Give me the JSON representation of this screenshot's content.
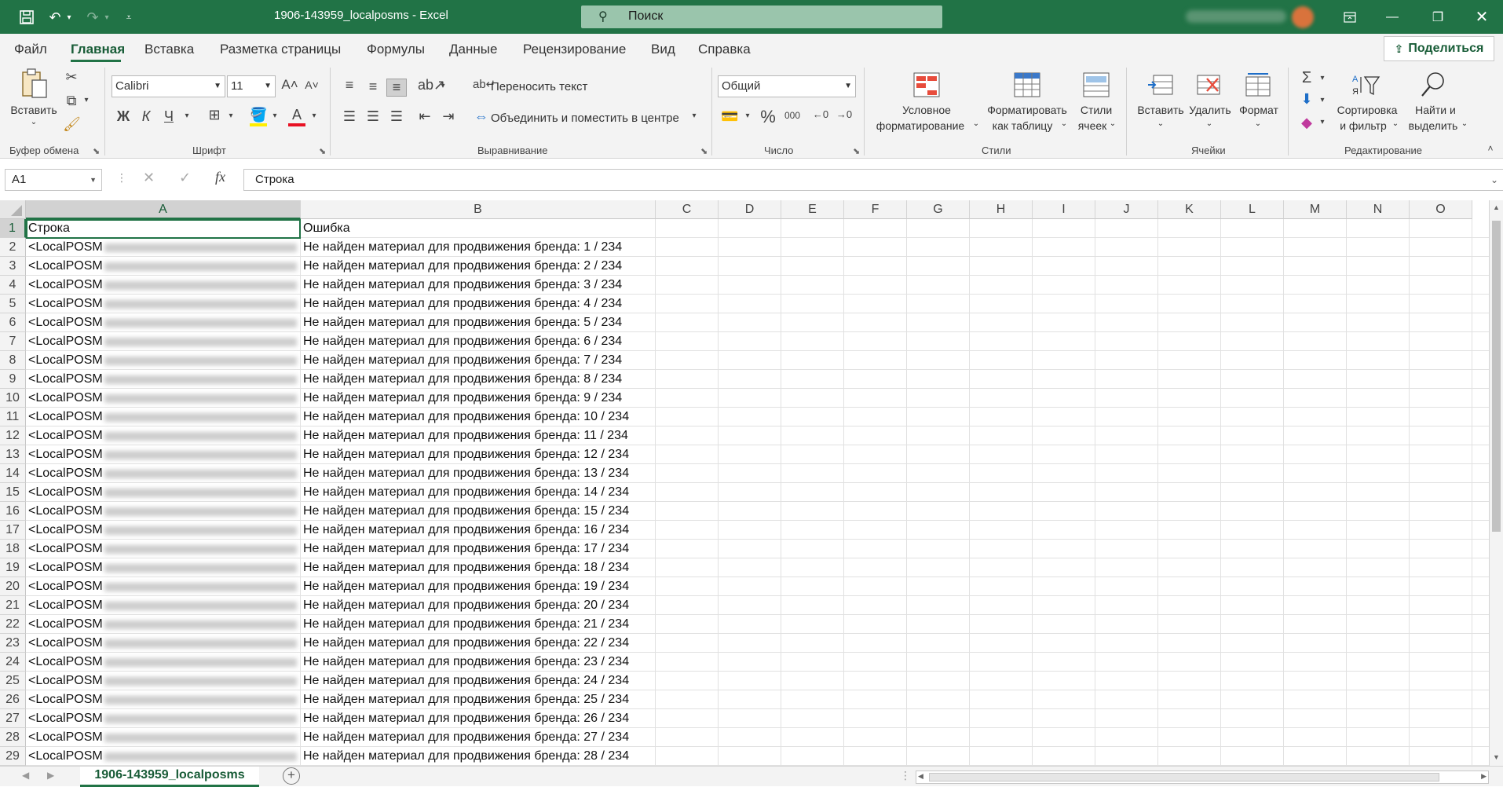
{
  "titlebar": {
    "title": "1906-143959_localposms  -  Excel",
    "search_placeholder": "Поиск",
    "accent": "#217346"
  },
  "menu": {
    "tabs": [
      "Файл",
      "Главная",
      "Вставка",
      "Разметка страницы",
      "Формулы",
      "Данные",
      "Рецензирование",
      "Вид",
      "Справка"
    ],
    "share_label": "Поделиться"
  },
  "ribbon": {
    "clipboard": {
      "paste_label": "Вставить",
      "group_label": "Буфер обмена"
    },
    "font": {
      "font_name": "Calibri",
      "font_size": "11",
      "group_label": "Шрифт",
      "bold": "Ж",
      "italic": "К",
      "underline": "Ч",
      "font_color": "#e81123"
    },
    "alignment": {
      "wrap_text": "Переносить текст",
      "merge_center": "Объединить и поместить в центре",
      "group_label": "Выравнивание"
    },
    "number": {
      "format": "Общий",
      "group_label": "Число"
    },
    "styles": {
      "conditional_line1": "Условное",
      "conditional_line2": "форматирование",
      "format_table_line1": "Форматировать",
      "format_table_line2": "как таблицу",
      "cell_styles_line1": "Стили",
      "cell_styles_line2": "ячеек",
      "group_label": "Стили"
    },
    "cells": {
      "insert": "Вставить",
      "delete": "Удалить",
      "format": "Формат",
      "group_label": "Ячейки"
    },
    "editing": {
      "sort_line1": "Сортировка",
      "sort_line2": "и фильтр",
      "find_line1": "Найти и",
      "find_line2": "выделить",
      "group_label": "Редактирование"
    }
  },
  "formula_bar": {
    "name_box": "A1",
    "content": "Строка"
  },
  "grid": {
    "columns": [
      "A",
      "B",
      "C",
      "D",
      "E",
      "F",
      "G",
      "H",
      "I",
      "J",
      "K",
      "L",
      "M",
      "N",
      "O"
    ],
    "selected_column": "A",
    "selected_row": "1",
    "rows": [
      {
        "num": "1",
        "a": "Строка",
        "b": "Ошибка"
      },
      {
        "num": "2",
        "a": "<LocalPOSM",
        "b": "Не найден материал для продвижения бренда: 1 / 234"
      },
      {
        "num": "3",
        "a": "<LocalPOSM",
        "b": "Не найден материал для продвижения бренда: 2 / 234"
      },
      {
        "num": "4",
        "a": "<LocalPOSM",
        "b": "Не найден материал для продвижения бренда: 3 / 234"
      },
      {
        "num": "5",
        "a": "<LocalPOSM",
        "b": "Не найден материал для продвижения бренда: 4 / 234"
      },
      {
        "num": "6",
        "a": "<LocalPOSM",
        "b": "Не найден материал для продвижения бренда: 5 / 234"
      },
      {
        "num": "7",
        "a": "<LocalPOSM",
        "b": "Не найден материал для продвижения бренда: 6 / 234"
      },
      {
        "num": "8",
        "a": "<LocalPOSM",
        "b": "Не найден материал для продвижения бренда: 7 / 234"
      },
      {
        "num": "9",
        "a": "<LocalPOSM",
        "b": "Не найден материал для продвижения бренда: 8 / 234"
      },
      {
        "num": "10",
        "a": "<LocalPOSM",
        "b": "Не найден материал для продвижения бренда: 9 / 234"
      },
      {
        "num": "11",
        "a": "<LocalPOSM",
        "b": "Не найден материал для продвижения бренда: 10 / 234"
      },
      {
        "num": "12",
        "a": "<LocalPOSM",
        "b": "Не найден материал для продвижения бренда: 11 / 234"
      },
      {
        "num": "13",
        "a": "<LocalPOSM",
        "b": "Не найден материал для продвижения бренда: 12 / 234"
      },
      {
        "num": "14",
        "a": "<LocalPOSM",
        "b": "Не найден материал для продвижения бренда: 13 / 234"
      },
      {
        "num": "15",
        "a": "<LocalPOSM",
        "b": "Не найден материал для продвижения бренда: 14 / 234"
      },
      {
        "num": "16",
        "a": "<LocalPOSM",
        "b": "Не найден материал для продвижения бренда: 15 / 234"
      },
      {
        "num": "17",
        "a": "<LocalPOSM",
        "b": "Не найден материал для продвижения бренда: 16 / 234"
      },
      {
        "num": "18",
        "a": "<LocalPOSM",
        "b": "Не найден материал для продвижения бренда: 17 / 234"
      },
      {
        "num": "19",
        "a": "<LocalPOSM",
        "b": "Не найден материал для продвижения бренда: 18 / 234"
      },
      {
        "num": "20",
        "a": "<LocalPOSM",
        "b": "Не найден материал для продвижения бренда: 19 / 234"
      },
      {
        "num": "21",
        "a": "<LocalPOSM",
        "b": "Не найден материал для продвижения бренда: 20 / 234"
      },
      {
        "num": "22",
        "a": "<LocalPOSM",
        "b": "Не найден материал для продвижения бренда: 21 / 234"
      },
      {
        "num": "23",
        "a": "<LocalPOSM",
        "b": "Не найден материал для продвижения бренда: 22 / 234"
      },
      {
        "num": "24",
        "a": "<LocalPOSM",
        "b": "Не найден материал для продвижения бренда: 23 / 234"
      },
      {
        "num": "25",
        "a": "<LocalPOSM",
        "b": "Не найден материал для продвижения бренда: 24 / 234"
      },
      {
        "num": "26",
        "a": "<LocalPOSM",
        "b": "Не найден материал для продвижения бренда: 25 / 234"
      },
      {
        "num": "27",
        "a": "<LocalPOSM",
        "b": "Не найден материал для продвижения бренда: 26 / 234"
      },
      {
        "num": "28",
        "a": "<LocalPOSM",
        "b": "Не найден материал для продвижения бренда: 27 / 234"
      },
      {
        "num": "29",
        "a": "<LocalPOSM",
        "b": "Не найден материал для продвижения бренда: 28 / 234"
      }
    ]
  },
  "sheets": {
    "active": "1906-143959_localposms"
  }
}
